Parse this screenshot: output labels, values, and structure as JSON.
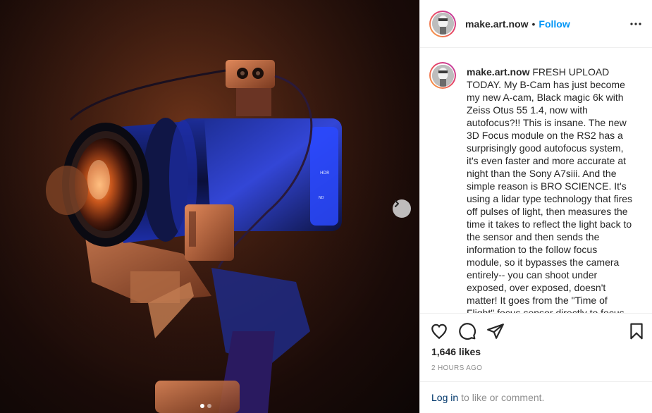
{
  "post": {
    "username": "make.art.now",
    "separator": "•",
    "follow_label": "Follow",
    "caption": "FRESH UPLOAD TODAY. My B-Cam has just become my new A-cam, Black magic 6k with Zeiss Otus 55 1.4, now with autofocus?!! This is insane. The new 3D Focus module on the RS2 has a surprisingly good autofocus system, it's even faster and more accurate at night than the Sony A7siii. And the simple reason is BRO SCIENCE. It's using a lidar type technology that fires off pulses of light, then measures the time it takes to reflect the light back to the sensor and then sends the information to the follow focus module, so it bypasses the camera entirely-- you can shoot under exposed, over exposed, doesn't matter! It goes from the \"Time of Flight\" focus sensor directly to focus motor. It makes run-n-gun shooting so much easier.",
    "likes": "1,646 likes",
    "timestamp": "2 HOURS AGO"
  },
  "comment_bar": {
    "login_label": "Log in",
    "suffix": "to like or comment."
  },
  "carousel": {
    "slides": 2,
    "active": 1
  },
  "icons": {
    "like": "heart-icon",
    "comment": "comment-bubble-icon",
    "share": "paper-plane-icon",
    "save": "bookmark-icon",
    "more": "more-options-icon",
    "next": "chevron-right-icon"
  },
  "colors": {
    "follow": "#0095f6",
    "login_link": "#00376b",
    "muted": "#8e8e8e",
    "text": "#262626"
  }
}
